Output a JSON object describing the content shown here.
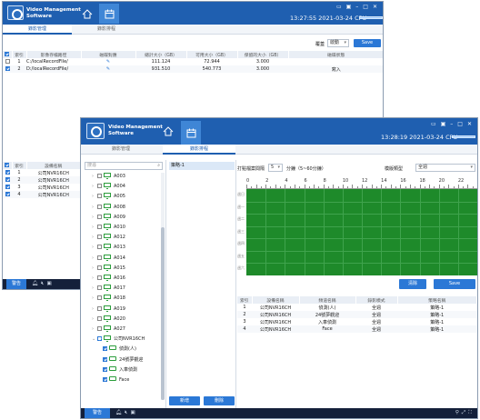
{
  "back": {
    "app_name_line1": "Video Management",
    "app_name_line2": "Software",
    "clock": "13:27:55 2021-03-24 CPU",
    "tabs": [
      "錄影管理",
      "錄影排程"
    ],
    "top_table": {
      "overwrite_label": "覆蓋",
      "overwrite_value": "啟動",
      "save_label": "Save",
      "headers": [
        "索引",
        "影像存檔路徑",
        "磁碟對應",
        "總計大小（GB）",
        "可用大小（GB）",
        "保留的大小（GB）",
        "磁碟狀態"
      ],
      "rows": [
        {
          "idx": "1",
          "path": "C:/localRecordFile/",
          "total": "111.124",
          "avail": "72.944",
          "reserve": "3.000",
          "status": ""
        },
        {
          "idx": "2",
          "path": "D:/localRecordFile/",
          "total": "931.510",
          "avail": "540.773",
          "reserve": "3.000",
          "status": "寫入"
        }
      ]
    },
    "bottom_table": {
      "headers": [
        "索引",
        "設備名稱"
      ],
      "rows": [
        {
          "idx": "1",
          "name": "公司NVR16CH"
        },
        {
          "idx": "2",
          "name": "公司NVR16CH"
        },
        {
          "idx": "3",
          "name": "公司NVR16CH"
        },
        {
          "idx": "4",
          "name": "公司NVR16CH"
        }
      ]
    },
    "alarm_label": "警告"
  },
  "front": {
    "app_name_line1": "Video Management",
    "app_name_line2": "Software",
    "clock": "13:28:19 2021-03-24 CPU",
    "tabs": [
      "錄影管理",
      "錄影排程"
    ],
    "search_placeholder": "搜尋",
    "tree": [
      {
        "label": "A003"
      },
      {
        "label": "A004"
      },
      {
        "label": "A005"
      },
      {
        "label": "A008"
      },
      {
        "label": "A009"
      },
      {
        "label": "A010"
      },
      {
        "label": "A012"
      },
      {
        "label": "A013"
      },
      {
        "label": "A014"
      },
      {
        "label": "A015"
      },
      {
        "label": "A016"
      },
      {
        "label": "A017"
      },
      {
        "label": "A018"
      },
      {
        "label": "A019"
      },
      {
        "label": "A020"
      },
      {
        "label": "A027"
      }
    ],
    "tree_group": "公司NVR16CH",
    "tree_children": [
      "偵測(人)",
      "24號夢觀迎",
      "入車偵測",
      "Face"
    ],
    "policy_name": "策略-1",
    "add_label": "新增",
    "delete_label": "刪除",
    "interval_label": "打點檔案間隔",
    "interval_value": "5",
    "interval_unit": "分鐘（5~60分鐘）",
    "template_label": "模版類型",
    "template_value": "全週",
    "hours": [
      "0",
      "2",
      "4",
      "6",
      "8",
      "10",
      "12",
      "14",
      "16",
      "18",
      "20",
      "22"
    ],
    "days": [
      "週日",
      "週一",
      "週二",
      "週三",
      "週四",
      "週五",
      "週六"
    ],
    "clear_label": "清除",
    "save_label": "Save",
    "table": {
      "headers": [
        "索引",
        "設備名稱",
        "頻道名稱",
        "錄影模式",
        "策略名稱"
      ],
      "rows": [
        {
          "idx": "1",
          "device": "公司NVR16CH",
          "channel": "偵測(人)",
          "mode": "全週",
          "policy": "策略-1"
        },
        {
          "idx": "2",
          "device": "公司NVR16CH",
          "channel": "24號夢觀迎",
          "mode": "全週",
          "policy": "策略-1"
        },
        {
          "idx": "3",
          "device": "公司NVR16CH",
          "channel": "入車偵測",
          "mode": "全週",
          "policy": "策略-1"
        },
        {
          "idx": "4",
          "device": "公司NVR16CH",
          "channel": "Face",
          "mode": "全週",
          "policy": "策略-1"
        }
      ]
    },
    "alarm_label": "警告"
  }
}
